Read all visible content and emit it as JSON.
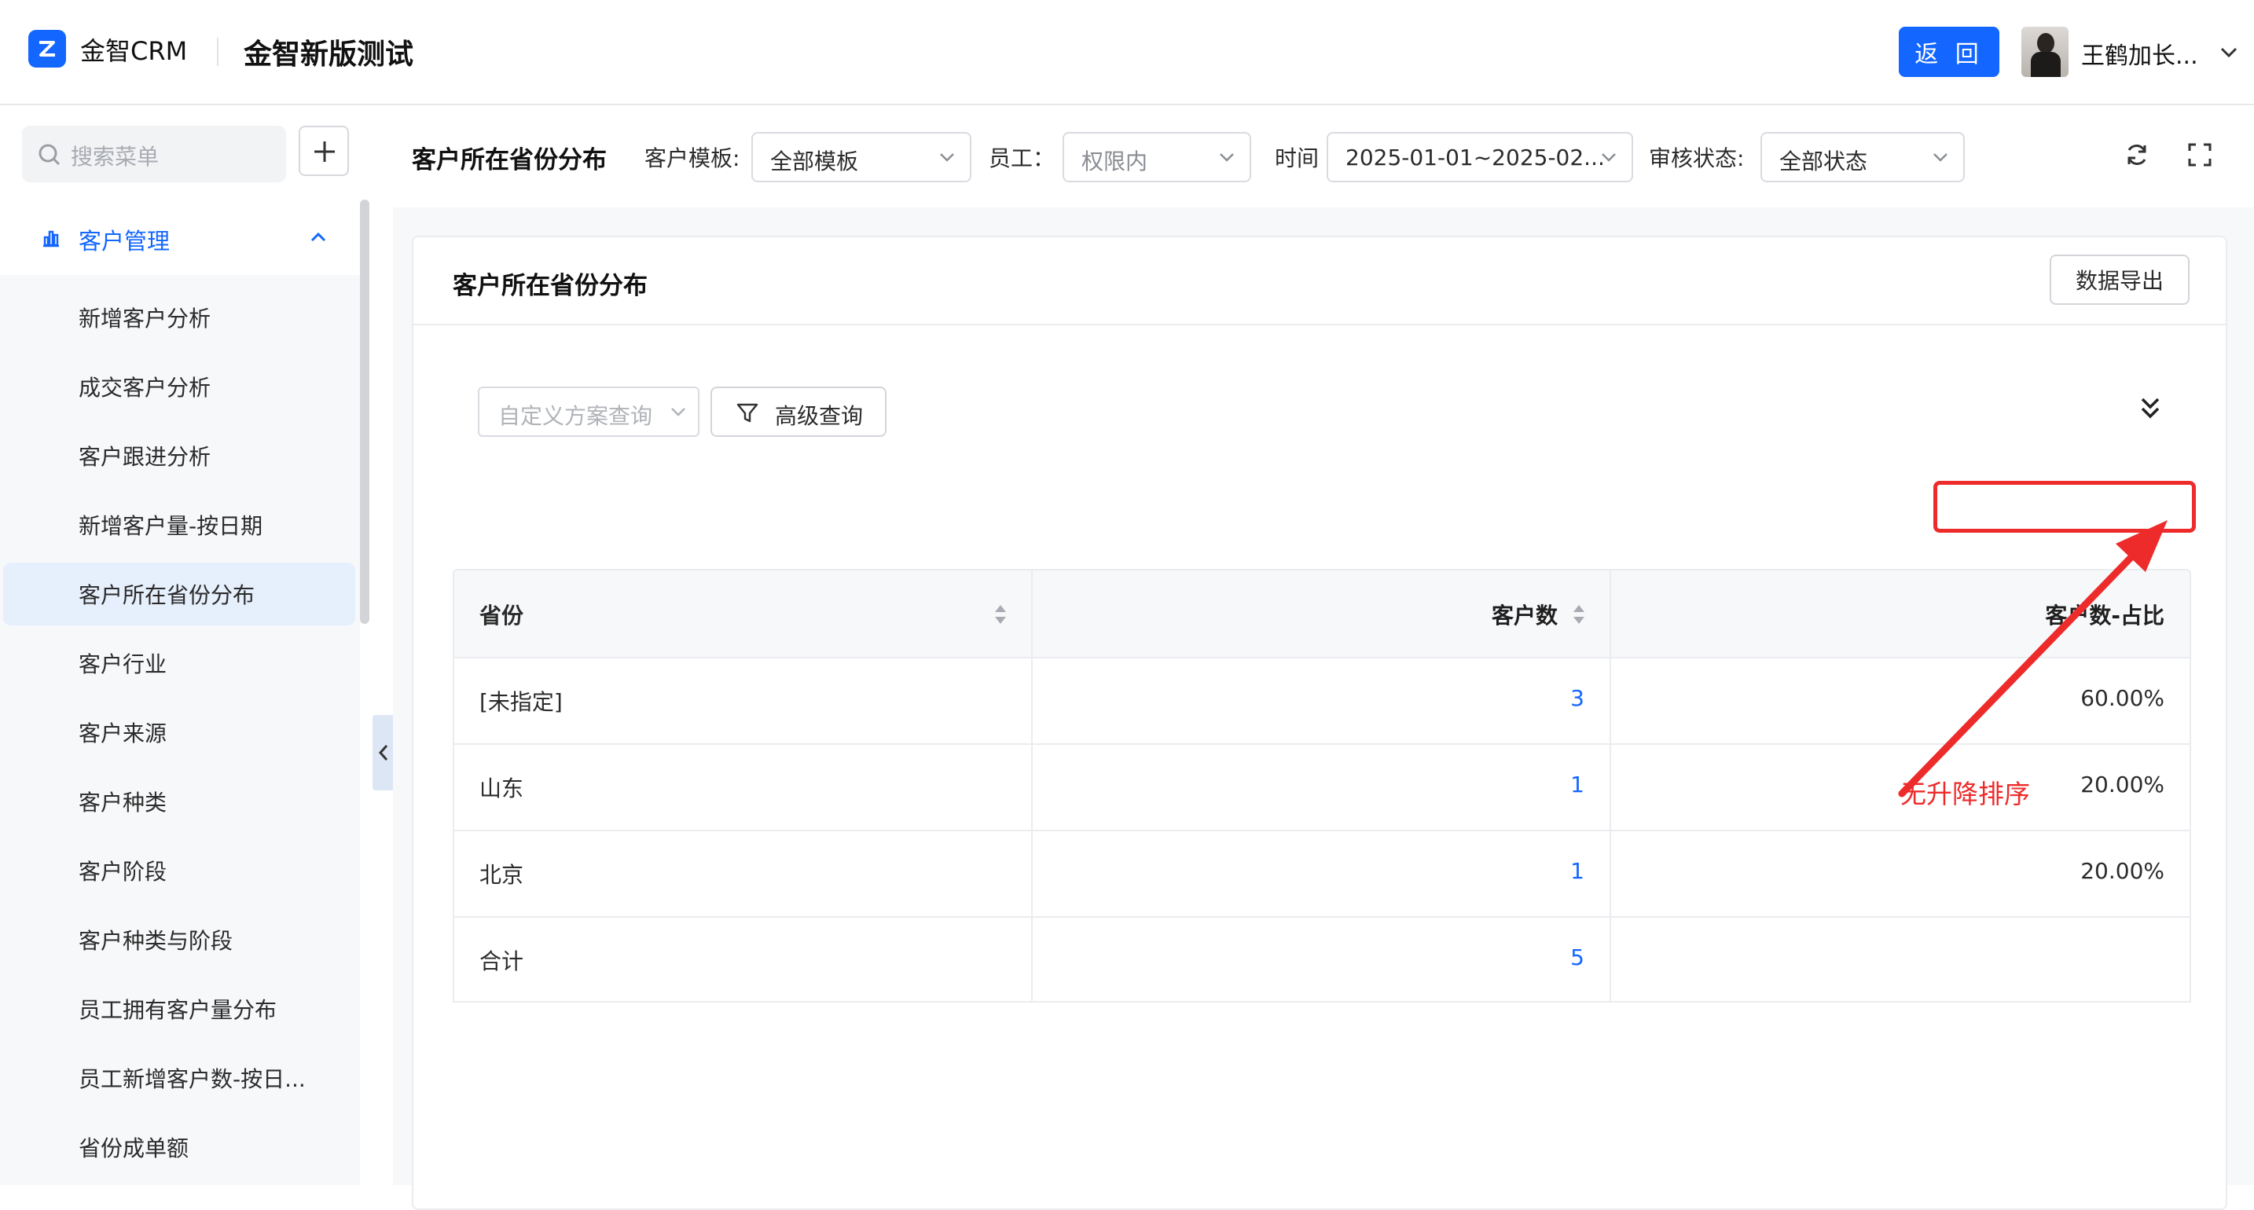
{
  "header": {
    "brand": "金智CRM",
    "app_title": "金智新版测试",
    "back_label": "返 回",
    "username": "王鹤加长..."
  },
  "sidebar": {
    "search_placeholder": "搜索菜单",
    "group_label": "客户管理",
    "items": [
      {
        "label": "新增客户分析"
      },
      {
        "label": "成交客户分析"
      },
      {
        "label": "客户跟进分析"
      },
      {
        "label": "新增客户量-按日期"
      },
      {
        "label": "客户所在省份分布",
        "active": true
      },
      {
        "label": "客户行业"
      },
      {
        "label": "客户来源"
      },
      {
        "label": "客户种类"
      },
      {
        "label": "客户阶段"
      },
      {
        "label": "客户种类与阶段"
      },
      {
        "label": "员工拥有客户量分布"
      },
      {
        "label": "员工新增客户数-按日..."
      },
      {
        "label": "省份成单额"
      }
    ]
  },
  "filters": {
    "page_title": "客户所在省份分布",
    "template_label": "客户模板:",
    "template_value": "全部模板",
    "employee_label": "员工：",
    "employee_value": "权限内",
    "time_label": "时间",
    "time_value": "2025-01-01~2025-02...",
    "status_label": "审核状态:",
    "status_value": "全部状态"
  },
  "card": {
    "title": "客户所在省份分布",
    "export_label": "数据导出",
    "scheme_placeholder": "自定义方案查询",
    "advanced_label": "高级查询"
  },
  "table": {
    "headers": [
      "省份",
      "客户数",
      "客户数-占比"
    ],
    "rows": [
      {
        "province": "[未指定]",
        "count": "3",
        "ratio": "60.00%"
      },
      {
        "province": "山东",
        "count": "1",
        "ratio": "20.00%"
      },
      {
        "province": "北京",
        "count": "1",
        "ratio": "20.00%"
      },
      {
        "province": "合计",
        "count": "5",
        "ratio": ""
      }
    ]
  },
  "annotation": {
    "text": "无升降排序",
    "color": "#ee2b2b"
  },
  "colors": {
    "accent": "#1366ff",
    "active_menu_bg": "#e6effc"
  }
}
